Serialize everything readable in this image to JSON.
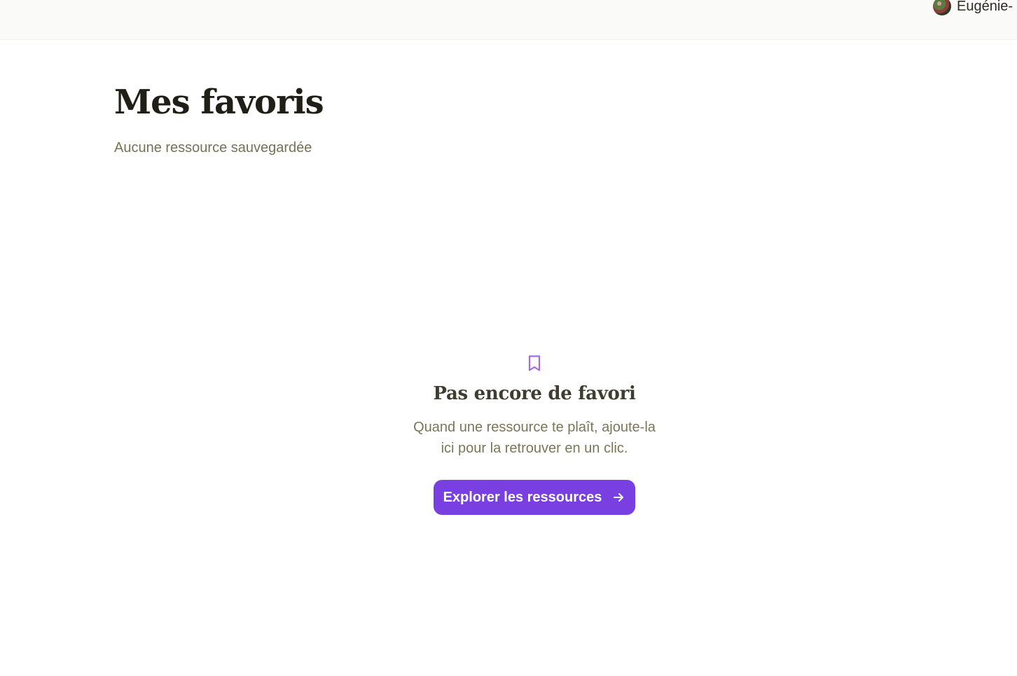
{
  "header": {
    "user": {
      "name": "Eugénie-",
      "avatar_icon": "user-avatar-icon"
    }
  },
  "page": {
    "title": "Mes favoris",
    "subtitle": "Aucune ressource sauvegardée"
  },
  "empty_state": {
    "icon": "bookmark-icon",
    "title": "Pas encore de favori",
    "description": "Quand une ressource te plaît, ajoute-la ici pour la retrouver en un clic.",
    "button_label": "Explorer les ressources",
    "button_icon": "arrow-right-icon"
  },
  "colors": {
    "accent": "#7A3FE0",
    "background": "#FFFFFF",
    "topbar_background": "#FAFAF8",
    "title_text": "#1F1F17",
    "muted_text": "#767254"
  }
}
